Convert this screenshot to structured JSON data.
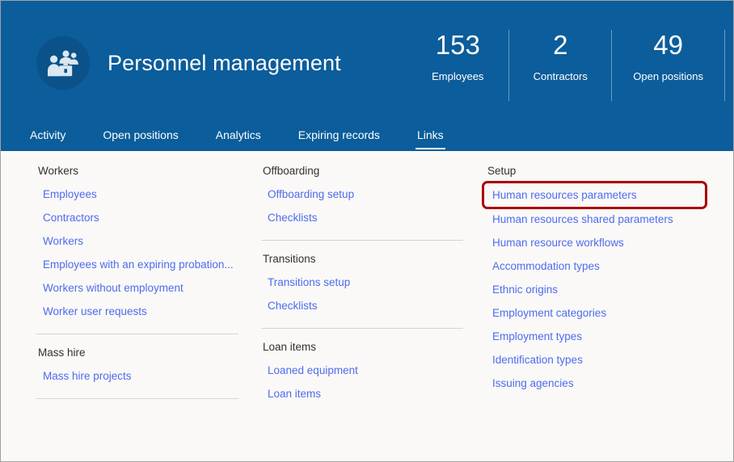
{
  "header": {
    "title": "Personnel management",
    "icon": "people-briefcase-icon",
    "background_color": "#0b5d9b",
    "stats": [
      {
        "value": "153",
        "label": "Employees"
      },
      {
        "value": "2",
        "label": "Contractors"
      },
      {
        "value": "49",
        "label": "Open positions"
      }
    ],
    "tabs": [
      {
        "label": "Activity",
        "active": false
      },
      {
        "label": "Open positions",
        "active": false
      },
      {
        "label": "Analytics",
        "active": false
      },
      {
        "label": "Expiring records",
        "active": false
      },
      {
        "label": "Links",
        "active": true
      }
    ]
  },
  "colors": {
    "header_blue": "#0b5d9b",
    "link_blue": "#4f6bed",
    "highlight_red": "#ad0000",
    "content_background": "#faf9f8",
    "divider": "#d6d4d2"
  },
  "links_page": {
    "columns": [
      {
        "groups": [
          {
            "title": "Workers",
            "links": [
              "Employees",
              "Contractors",
              "Workers",
              "Employees with an expiring probation...",
              "Workers without employment",
              "Worker user requests"
            ],
            "divider_after": true
          },
          {
            "title": "Mass hire",
            "links": [
              "Mass hire projects"
            ],
            "divider_after": true
          }
        ]
      },
      {
        "groups": [
          {
            "title": "Offboarding",
            "links": [
              "Offboarding setup",
              "Checklists"
            ],
            "divider_after": true
          },
          {
            "title": "Transitions",
            "links": [
              "Transitions setup",
              "Checklists"
            ],
            "divider_after": true
          },
          {
            "title": "Loan items",
            "links": [
              "Loaned equipment",
              "Loan items"
            ],
            "divider_after": false
          }
        ]
      },
      {
        "groups": [
          {
            "title": "Setup",
            "links": [
              "Human resources parameters",
              "Human resources shared parameters",
              "Human resource workflows",
              "Accommodation types",
              "Ethnic origins",
              "Employment categories",
              "Employment types",
              "Identification types",
              "Issuing agencies"
            ],
            "highlighted_link": "Human resources parameters",
            "divider_after": false
          }
        ]
      }
    ]
  }
}
